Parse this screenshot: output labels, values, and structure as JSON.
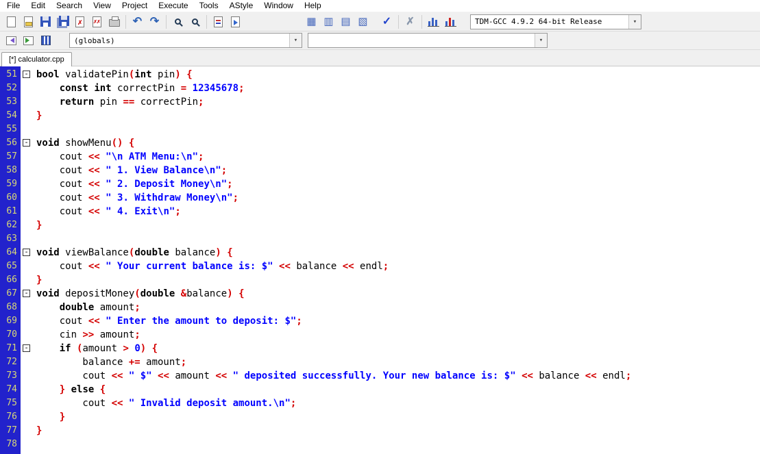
{
  "menu": {
    "items": [
      {
        "label": "File"
      },
      {
        "label": "Edit"
      },
      {
        "label": "Search"
      },
      {
        "label": "View"
      },
      {
        "label": "Project"
      },
      {
        "label": "Execute"
      },
      {
        "label": "Tools"
      },
      {
        "label": "AStyle"
      },
      {
        "label": "Window"
      },
      {
        "label": "Help"
      }
    ]
  },
  "toolbar": {
    "compiler_selected": "TDM-GCC 4.9.2 64-bit Release",
    "icons": [
      "new-file",
      "open-file",
      "save",
      "save-all",
      "close-file",
      "close-all",
      "print",
      "undo",
      "redo",
      "find",
      "find-in-files",
      "replace",
      "goto-line",
      "project-manager-toggle",
      "statusbar-toggle",
      "report-window-toggle",
      "class-browser-toggle",
      "syntax-check",
      "abort-compilation",
      "profile-analysis",
      "delete-profiling"
    ]
  },
  "glyphs": {
    "undo": "↶",
    "redo": "↷",
    "grid_a": "▦",
    "grid_b": "▥",
    "grid_c": "▤",
    "grid_d": "▧",
    "check": "✓",
    "abort": "✗",
    "dropdown_arrow": "▾",
    "fold_collapse": "-"
  },
  "browser": {
    "scope_selected": "(globals)",
    "member_selected": ""
  },
  "tabs": [
    {
      "label": "[*] calculator.cpp",
      "active": true
    }
  ],
  "editor": {
    "language": "cpp",
    "first_line": 51,
    "last_line": 78,
    "colors": {
      "gutter_bg": "#2222cc",
      "line_number": "#d8d878",
      "keyword": "#000000",
      "string": "#0000ff",
      "number": "#0000ff",
      "operator": "#d40000",
      "plain": "#000000"
    },
    "lines": [
      {
        "n": "51",
        "f": true,
        "tok": [
          [
            "k",
            "bool"
          ],
          [
            "t",
            " validatePin"
          ],
          [
            "o",
            "("
          ],
          [
            "k",
            "int"
          ],
          [
            "t",
            " pin"
          ],
          [
            "o",
            ")"
          ],
          [
            "t",
            " "
          ],
          [
            "o",
            "{"
          ]
        ]
      },
      {
        "n": "52",
        "f": false,
        "tok": [
          [
            "t",
            "    "
          ],
          [
            "k",
            "const"
          ],
          [
            "t",
            " "
          ],
          [
            "k",
            "int"
          ],
          [
            "t",
            " correctPin "
          ],
          [
            "o",
            "="
          ],
          [
            "t",
            " "
          ],
          [
            "n",
            "12345678"
          ],
          [
            "o",
            ";"
          ]
        ]
      },
      {
        "n": "53",
        "f": false,
        "tok": [
          [
            "t",
            "    "
          ],
          [
            "k",
            "return"
          ],
          [
            "t",
            " pin "
          ],
          [
            "o",
            "=="
          ],
          [
            "t",
            " correctPin"
          ],
          [
            "o",
            ";"
          ]
        ]
      },
      {
        "n": "54",
        "f": false,
        "tok": [
          [
            "o",
            "}"
          ]
        ]
      },
      {
        "n": "55",
        "f": false,
        "tok": []
      },
      {
        "n": "56",
        "f": true,
        "tok": [
          [
            "k",
            "void"
          ],
          [
            "t",
            " showMenu"
          ],
          [
            "o",
            "()"
          ],
          [
            "t",
            " "
          ],
          [
            "o",
            "{"
          ]
        ]
      },
      {
        "n": "57",
        "f": false,
        "tok": [
          [
            "t",
            "    cout "
          ],
          [
            "o",
            "<<"
          ],
          [
            "t",
            " "
          ],
          [
            "s",
            "\"\\n ATM Menu:\\n\""
          ],
          [
            "o",
            ";"
          ]
        ]
      },
      {
        "n": "58",
        "f": false,
        "tok": [
          [
            "t",
            "    cout "
          ],
          [
            "o",
            "<<"
          ],
          [
            "t",
            " "
          ],
          [
            "s",
            "\" 1. View Balance\\n\""
          ],
          [
            "o",
            ";"
          ]
        ]
      },
      {
        "n": "59",
        "f": false,
        "tok": [
          [
            "t",
            "    cout "
          ],
          [
            "o",
            "<<"
          ],
          [
            "t",
            " "
          ],
          [
            "s",
            "\" 2. Deposit Money\\n\""
          ],
          [
            "o",
            ";"
          ]
        ]
      },
      {
        "n": "60",
        "f": false,
        "tok": [
          [
            "t",
            "    cout "
          ],
          [
            "o",
            "<<"
          ],
          [
            "t",
            " "
          ],
          [
            "s",
            "\" 3. Withdraw Money\\n\""
          ],
          [
            "o",
            ";"
          ]
        ]
      },
      {
        "n": "61",
        "f": false,
        "tok": [
          [
            "t",
            "    cout "
          ],
          [
            "o",
            "<<"
          ],
          [
            "t",
            " "
          ],
          [
            "s",
            "\" 4. Exit\\n\""
          ],
          [
            "o",
            ";"
          ]
        ]
      },
      {
        "n": "62",
        "f": false,
        "tok": [
          [
            "o",
            "}"
          ]
        ]
      },
      {
        "n": "63",
        "f": false,
        "tok": []
      },
      {
        "n": "64",
        "f": true,
        "tok": [
          [
            "k",
            "void"
          ],
          [
            "t",
            " viewBalance"
          ],
          [
            "o",
            "("
          ],
          [
            "k",
            "double"
          ],
          [
            "t",
            " balance"
          ],
          [
            "o",
            ")"
          ],
          [
            "t",
            " "
          ],
          [
            "o",
            "{"
          ]
        ]
      },
      {
        "n": "65",
        "f": false,
        "tok": [
          [
            "t",
            "    cout "
          ],
          [
            "o",
            "<<"
          ],
          [
            "t",
            " "
          ],
          [
            "s",
            "\" Your current balance is: $\""
          ],
          [
            "t",
            " "
          ],
          [
            "o",
            "<<"
          ],
          [
            "t",
            " balance "
          ],
          [
            "o",
            "<<"
          ],
          [
            "t",
            " endl"
          ],
          [
            "o",
            ";"
          ]
        ]
      },
      {
        "n": "66",
        "f": false,
        "tok": [
          [
            "o",
            "}"
          ]
        ]
      },
      {
        "n": "67",
        "f": true,
        "tok": [
          [
            "k",
            "void"
          ],
          [
            "t",
            " depositMoney"
          ],
          [
            "o",
            "("
          ],
          [
            "k",
            "double"
          ],
          [
            "t",
            " "
          ],
          [
            "o",
            "&"
          ],
          [
            "t",
            "balance"
          ],
          [
            "o",
            ")"
          ],
          [
            "t",
            " "
          ],
          [
            "o",
            "{"
          ]
        ]
      },
      {
        "n": "68",
        "f": false,
        "tok": [
          [
            "t",
            "    "
          ],
          [
            "k",
            "double"
          ],
          [
            "t",
            " amount"
          ],
          [
            "o",
            ";"
          ]
        ]
      },
      {
        "n": "69",
        "f": false,
        "tok": [
          [
            "t",
            "    cout "
          ],
          [
            "o",
            "<<"
          ],
          [
            "t",
            " "
          ],
          [
            "s",
            "\" Enter the amount to deposit: $\""
          ],
          [
            "o",
            ";"
          ]
        ]
      },
      {
        "n": "70",
        "f": false,
        "tok": [
          [
            "t",
            "    cin "
          ],
          [
            "o",
            ">>"
          ],
          [
            "t",
            " amount"
          ],
          [
            "o",
            ";"
          ]
        ]
      },
      {
        "n": "71",
        "f": true,
        "tok": [
          [
            "t",
            "    "
          ],
          [
            "k",
            "if"
          ],
          [
            "t",
            " "
          ],
          [
            "o",
            "("
          ],
          [
            "t",
            "amount "
          ],
          [
            "o",
            ">"
          ],
          [
            "t",
            " "
          ],
          [
            "n",
            "0"
          ],
          [
            "o",
            ")"
          ],
          [
            "t",
            " "
          ],
          [
            "o",
            "{"
          ]
        ]
      },
      {
        "n": "72",
        "f": false,
        "tok": [
          [
            "t",
            "        balance "
          ],
          [
            "o",
            "+="
          ],
          [
            "t",
            " amount"
          ],
          [
            "o",
            ";"
          ]
        ]
      },
      {
        "n": "73",
        "f": false,
        "tok": [
          [
            "t",
            "        cout "
          ],
          [
            "o",
            "<<"
          ],
          [
            "t",
            " "
          ],
          [
            "s",
            "\" $\""
          ],
          [
            "t",
            " "
          ],
          [
            "o",
            "<<"
          ],
          [
            "t",
            " amount "
          ],
          [
            "o",
            "<<"
          ],
          [
            "t",
            " "
          ],
          [
            "s",
            "\" deposited successfully. Your new balance is: $\""
          ],
          [
            "t",
            " "
          ],
          [
            "o",
            "<<"
          ],
          [
            "t",
            " balance "
          ],
          [
            "o",
            "<<"
          ],
          [
            "t",
            " endl"
          ],
          [
            "o",
            ";"
          ]
        ]
      },
      {
        "n": "74",
        "f": false,
        "tok": [
          [
            "t",
            "    "
          ],
          [
            "o",
            "}"
          ],
          [
            "t",
            " "
          ],
          [
            "k",
            "else"
          ],
          [
            "t",
            " "
          ],
          [
            "o",
            "{"
          ]
        ]
      },
      {
        "n": "75",
        "f": false,
        "tok": [
          [
            "t",
            "        cout "
          ],
          [
            "o",
            "<<"
          ],
          [
            "t",
            " "
          ],
          [
            "s",
            "\" Invalid deposit amount.\\n\""
          ],
          [
            "o",
            ";"
          ]
        ]
      },
      {
        "n": "76",
        "f": false,
        "tok": [
          [
            "t",
            "    "
          ],
          [
            "o",
            "}"
          ]
        ]
      },
      {
        "n": "77",
        "f": false,
        "tok": [
          [
            "o",
            "}"
          ]
        ]
      },
      {
        "n": "78",
        "f": false,
        "tok": []
      }
    ]
  }
}
